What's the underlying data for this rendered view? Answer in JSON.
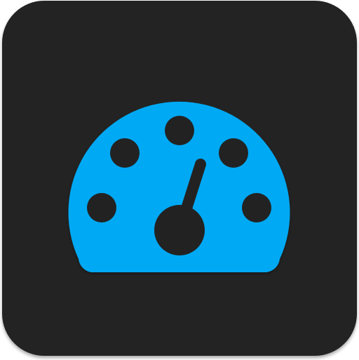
{
  "app_icon": {
    "icon": "speedometer-icon",
    "background_color": "#232323",
    "gauge_color": "#03A9F4",
    "hole_color": "#232323",
    "dial_markers": 5
  }
}
